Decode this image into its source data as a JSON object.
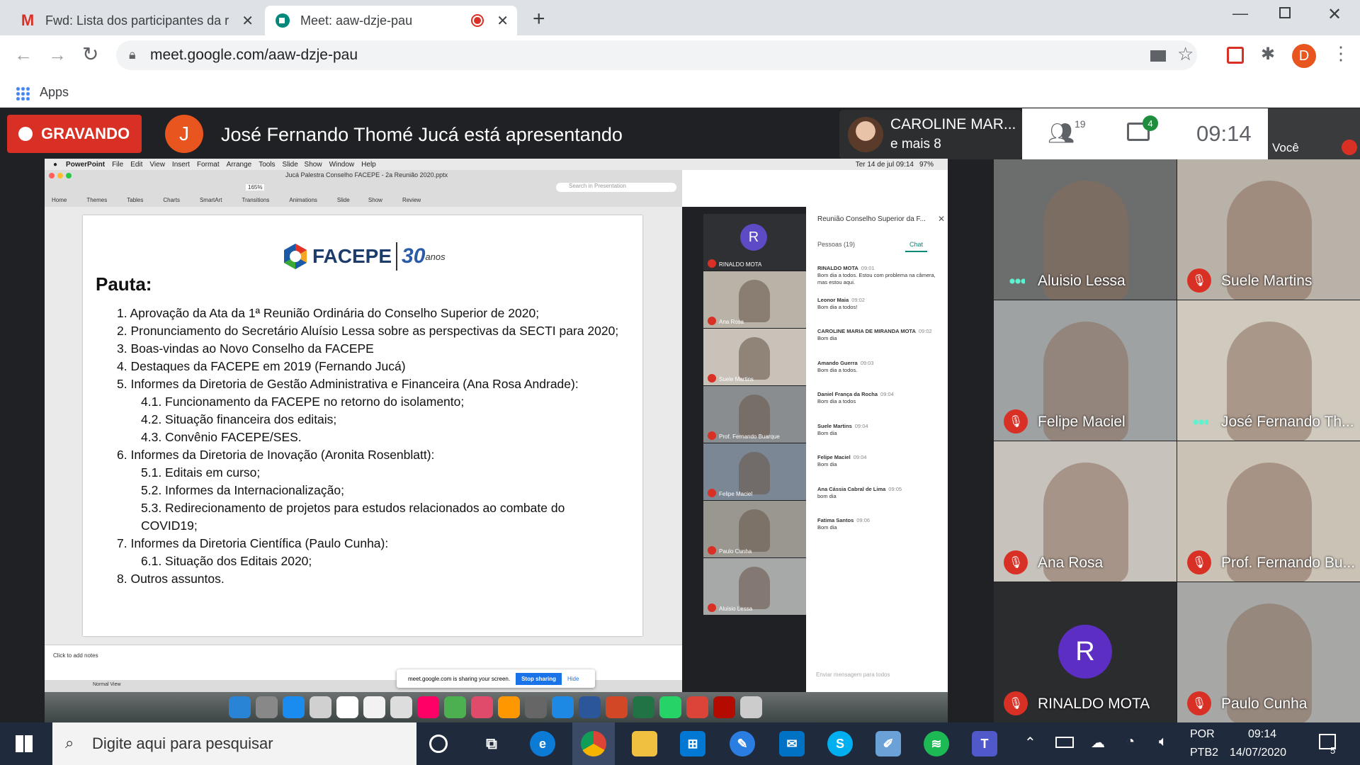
{
  "browser": {
    "tabs": [
      {
        "title": "Fwd: Lista dos participantes da re",
        "icon": "gmail-icon"
      },
      {
        "title": "Meet: aaw-dzje-pau",
        "icon": "meet-icon"
      }
    ],
    "url": "meet.google.com/aaw-dzje-pau",
    "bookmarks_apps": "Apps",
    "profile_initial": "D"
  },
  "meet": {
    "recording_label": "GRAVANDO",
    "presenter_initial": "J",
    "presenting_text": "José Fernando Thomé Jucá está apresentando",
    "participants_name": "CAROLINE MAR...",
    "participants_more": "e mais 8",
    "people_count": "19",
    "chat_badge": "4",
    "clock": "09:14",
    "self_label": "Você",
    "tiles": [
      {
        "name": "Aluisio Lessa",
        "muted": false
      },
      {
        "name": "Suele Martins",
        "muted": true
      },
      {
        "name": "Felipe Maciel",
        "muted": true
      },
      {
        "name": "José Fernando Th...",
        "muted": false
      },
      {
        "name": "Ana Rosa",
        "muted": true
      },
      {
        "name": "Prof. Fernando Bu...",
        "muted": true
      },
      {
        "name": "RINALDO MOTA",
        "muted": true,
        "initial": "R"
      },
      {
        "name": "Paulo Cunha",
        "muted": true
      }
    ]
  },
  "shared_screen": {
    "mac_menu": [
      "PowerPoint",
      "File",
      "Edit",
      "View",
      "Insert",
      "Format",
      "Arrange",
      "Tools",
      "Slide Show",
      "Window",
      "Help"
    ],
    "mac_clock": "Ter 14 de jul  09:14",
    "mac_battery": "97%",
    "doc_title": "Jucá Palestra  Conselho FACEPE - 2a Reunião 2020.pptx",
    "search_placeholder": "Search in Presentation",
    "zoom": "165%",
    "ribbon_tabs": [
      "Home",
      "Themes",
      "Tables",
      "Charts",
      "SmartArt",
      "Transitions",
      "Animations",
      "Slide Show",
      "Review"
    ],
    "logo_text": "FACEPE",
    "logo_years": "30",
    "logo_anos": "anos",
    "slide_title": "Pauta:",
    "agenda": [
      {
        "text": "1. Aprovação da Ata da 1ª Reunião Ordinária do Conselho Superior de 2020;",
        "level": 1
      },
      {
        "text": "2. Pronunciamento do Secretário Aluísio Lessa sobre as perspectivas da SECTI para 2020;",
        "level": 1
      },
      {
        "text": "3. Boas-vindas ao Novo Conselho da FACEPE",
        "level": 1
      },
      {
        "text": "4. Destaques da FACEPE em 2019 (Fernando Jucá)",
        "level": 1
      },
      {
        "text": "5. Informes da Diretoria de Gestão Administrativa e Financeira (Ana Rosa Andrade):",
        "level": 1
      },
      {
        "text": "4.1. Funcionamento da FACEPE no retorno do isolamento;",
        "level": 2
      },
      {
        "text": "4.2. Situação financeira dos editais;",
        "level": 2
      },
      {
        "text": "4.3. Convênio FACEPE/SES.",
        "level": 2
      },
      {
        "text": "6. Informes da Diretoria de Inovação (Aronita Rosenblatt):",
        "level": 1
      },
      {
        "text": "5.1. Editais em curso;",
        "level": 2
      },
      {
        "text": "5.2. Informes da Internacionalização;",
        "level": 2
      },
      {
        "text": "5.3. Redirecionamento de projetos para estudos relacionados ao combate do",
        "level": 2
      },
      {
        "text": "COVID19;",
        "level": 2
      },
      {
        "text": "7. Informes da Diretoria Científica (Paulo Cunha):",
        "level": 1
      },
      {
        "text": "6.1. Situação dos Editais 2020;",
        "level": 2
      },
      {
        "text": "8. Outros assuntos.",
        "level": 1
      }
    ],
    "notes_placeholder": "Click to add notes",
    "view_label": "Normal View",
    "sharing_text": "meet.google.com is sharing your screen.",
    "stop_sharing": "Stop sharing",
    "hide": "Hide",
    "inner_meet": {
      "title": "Reunião Conselho Superior da F...",
      "people_tab": "Pessoas (19)",
      "chat_tab": "Chat",
      "thumbs": [
        "RINALDO MOTA",
        "Ana Rosa",
        "Suele Martins",
        "Prof. Fernando Buarque",
        "Felipe Maciel",
        "Paulo Cunha",
        "Aluisio Lessa"
      ],
      "messages": [
        {
          "author": "RINALDO MOTA",
          "time": "09:01",
          "text": "Bom dia a todos. Estou com problema na câmera, mas estou aqui."
        },
        {
          "author": "Leonor Maia",
          "time": "09:02",
          "text": "Bom dia a todos!"
        },
        {
          "author": "CAROLINE MARIA DE MIRANDA MOTA",
          "time": "09:02",
          "text": "Bom dia"
        },
        {
          "author": "Amando Guerra",
          "time": "09:03",
          "text": "Bom dia a todos."
        },
        {
          "author": "Daniel França da Rocha",
          "time": "09:04",
          "text": "Bom dia a todos"
        },
        {
          "author": "Suele Martins",
          "time": "09:04",
          "text": "Bom dia"
        },
        {
          "author": "Felipe Maciel",
          "time": "09:04",
          "text": "Bom dia"
        },
        {
          "author": "Ana Cássia Cabral de Lima",
          "time": "09:05",
          "text": "bom dia"
        },
        {
          "author": "Fatima Santos",
          "time": "09:06",
          "text": "Bom dia"
        }
      ],
      "input_placeholder": "Enviar mensagem para todos"
    }
  },
  "taskbar": {
    "search_placeholder": "Digite aqui para pesquisar",
    "lang": "POR",
    "layout": "PTB2",
    "time": "09:14",
    "date": "14/07/2020",
    "notif_count": "5"
  }
}
